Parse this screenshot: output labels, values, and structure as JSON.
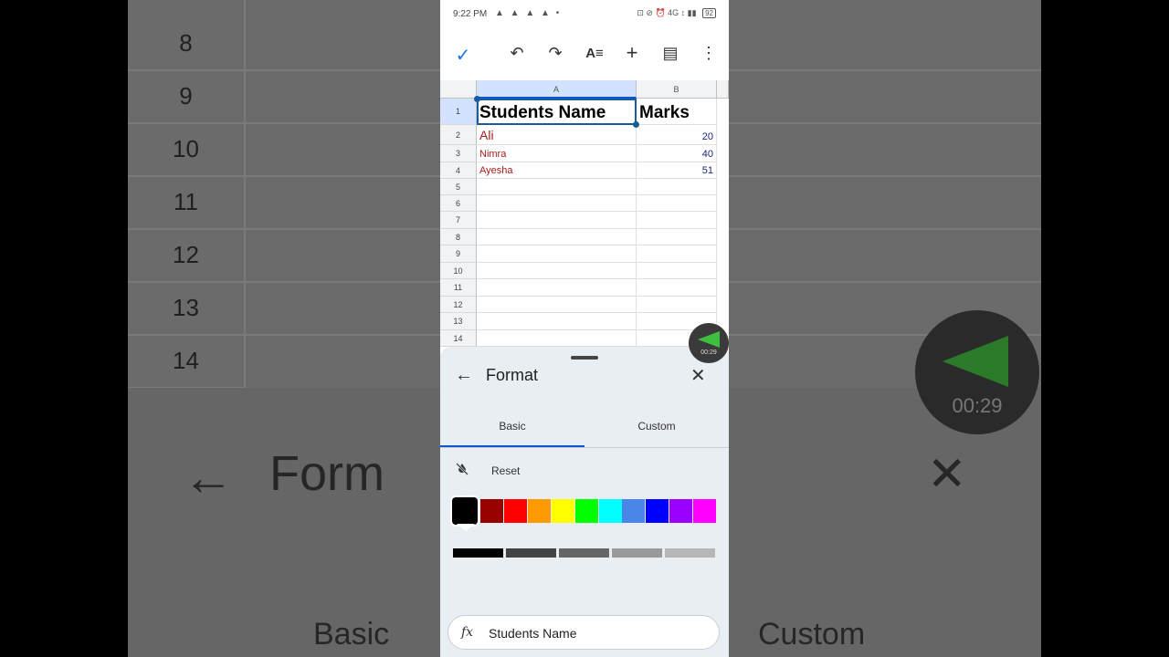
{
  "background": {
    "row_numbers": [
      "8",
      "9",
      "10",
      "11",
      "12",
      "13",
      "14"
    ],
    "format_text": "Form",
    "basic_text": "Basic",
    "custom_text": "Custom",
    "recorder_time": "00:29"
  },
  "status_bar": {
    "time": "9:22 PM",
    "notifications": "▲ ▲ ▲ ▲ •",
    "right": "⊡ ⊘ ⏰ 4G ↕ ▮▮",
    "battery": "92"
  },
  "toolbar": {
    "confirm_icon": "check-icon",
    "undo_icon": "undo-icon",
    "redo_icon": "redo-icon",
    "text_format_icon": "text-format-icon",
    "insert_icon": "plus-icon",
    "comment_icon": "comment-icon",
    "more_icon": "more-vert-icon"
  },
  "sheet": {
    "columns": [
      "A",
      "B"
    ],
    "rows": [
      "1",
      "2",
      "3",
      "4",
      "5",
      "6",
      "7",
      "8",
      "9",
      "10",
      "11",
      "12",
      "13",
      "14"
    ],
    "header_a": "Students Name",
    "header_b": "Marks",
    "data": [
      {
        "name": "Ali",
        "marks": "20"
      },
      {
        "name": "Nimra",
        "marks": "40"
      },
      {
        "name": "Ayesha",
        "marks": "51"
      }
    ],
    "name_color": "#a61c1c",
    "marks_color": "#1a237e",
    "selection_color": "#1a5c9a"
  },
  "recorder": {
    "time": "00:29"
  },
  "format_panel": {
    "title": "Format",
    "tabs": [
      "Basic",
      "Custom"
    ],
    "active_tab": "Basic",
    "reset_label": "Reset",
    "colors": [
      "#000000",
      "#990000",
      "#ff0000",
      "#ff9900",
      "#ffff00",
      "#00ff00",
      "#00ffff",
      "#4a86e8",
      "#0000ff",
      "#9900ff",
      "#ff00ff"
    ],
    "selected_color": "#000000",
    "grays": [
      "#000000",
      "#434343",
      "#666666",
      "#999999",
      "#b7b7b7"
    ]
  },
  "formula_bar": {
    "icon": "fx",
    "value": "Students Name"
  }
}
